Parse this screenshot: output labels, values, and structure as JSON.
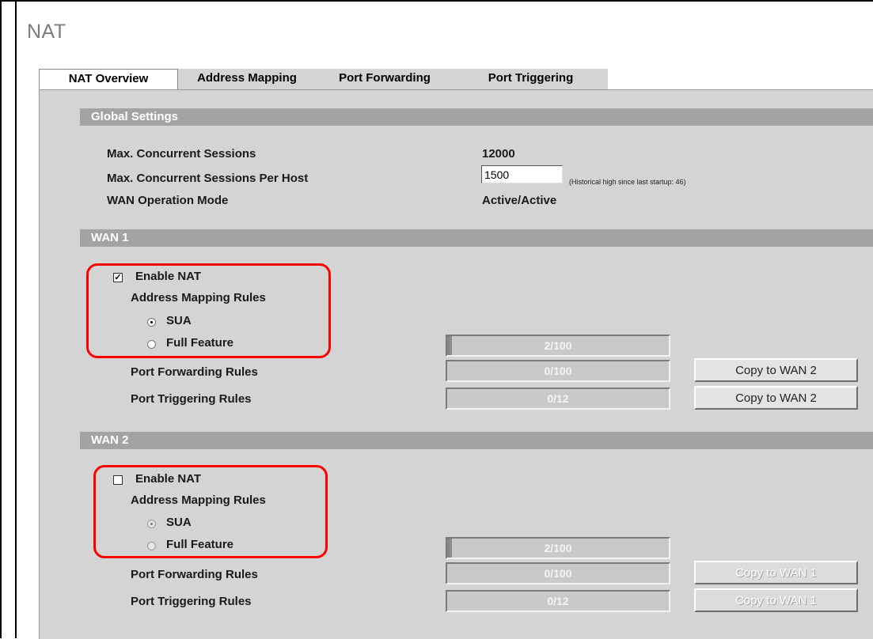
{
  "page_title": "NAT",
  "tabs": [
    {
      "label": "NAT Overview",
      "active": true
    },
    {
      "label": "Address Mapping",
      "active": false
    },
    {
      "label": "Port Forwarding",
      "active": false
    },
    {
      "label": "Port Triggering",
      "active": false
    }
  ],
  "global_settings": {
    "header": "Global Settings",
    "max_sessions_label": "Max. Concurrent Sessions",
    "max_sessions_value": "12000",
    "per_host_label": "Max. Concurrent Sessions Per Host",
    "per_host_value": "1500",
    "per_host_note": "(Historical high since last startup: 46)",
    "wan_mode_label": "WAN Operation Mode",
    "wan_mode_value": "Active/Active"
  },
  "wan1": {
    "header": "WAN 1",
    "enable_nat_label": "Enable NAT",
    "enable_nat_checked": true,
    "mapping_rules_label": "Address Mapping Rules",
    "sua_label": "SUA",
    "full_feature_label": "Full Feature",
    "selected_mode": "SUA",
    "address_mapping_usage": "2/100",
    "address_mapping_fraction": 0.02,
    "port_forwarding_label": "Port Forwarding Rules",
    "port_forwarding_usage": "0/100",
    "port_triggering_label": "Port Triggering Rules",
    "port_triggering_usage": "0/12",
    "copy_forwarding_button": "Copy to WAN 2",
    "copy_triggering_button": "Copy to WAN 2"
  },
  "wan2": {
    "header": "WAN 2",
    "enable_nat_label": "Enable NAT",
    "enable_nat_checked": false,
    "mapping_rules_label": "Address Mapping Rules",
    "sua_label": "SUA",
    "full_feature_label": "Full Feature",
    "selected_mode": "SUA",
    "address_mapping_usage": "2/100",
    "address_mapping_fraction": 0.02,
    "port_forwarding_label": "Port Forwarding Rules",
    "port_forwarding_usage": "0/100",
    "port_triggering_label": "Port Triggering Rules",
    "port_triggering_usage": "0/12",
    "copy_forwarding_button": "Copy to WAN 1",
    "copy_triggering_button": "Copy to WAN 1"
  },
  "colors": {
    "highlight": "#ff0000",
    "section_bar": "#a3a3a3",
    "panel_bg": "#d4d4d4"
  }
}
